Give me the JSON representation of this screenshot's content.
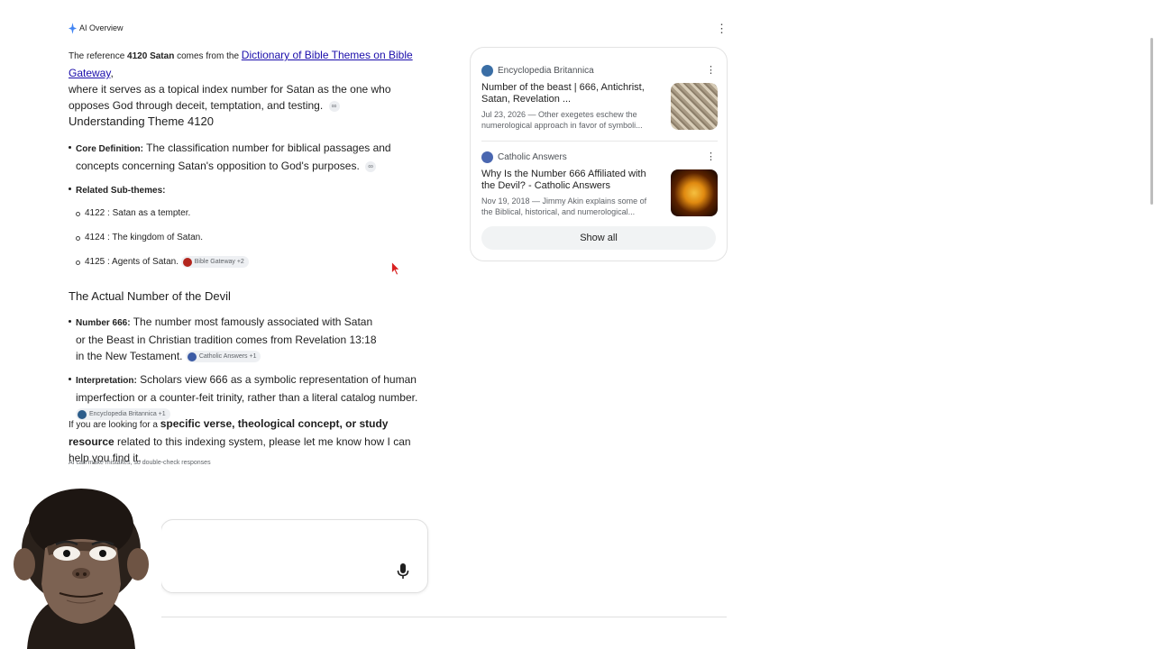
{
  "ai_overview": {
    "label": "AI Overview",
    "intro": {
      "t1": "The reference ",
      "t2": "4120 Satan",
      "t3": " comes from the ",
      "link": "Dictionary of Bible Themes on Bible Gateway",
      "t4": ",",
      "t5": "where it serves as a topical index number for Satan as the one who opposes God through deceit, temptation, and testing."
    },
    "section1": {
      "heading": "Understanding Theme 4120",
      "bullets": [
        {
          "bold": "Core Definition:",
          "text": " The classification number for biblical passages and concepts concerning Satan's opposition to God's purposes."
        },
        {
          "bold": "Related Sub-themes:",
          "text": ""
        }
      ],
      "subthemes": [
        "4122 : Satan as a tempter.",
        "4124 : The kingdom of Satan.",
        "4125 : Agents of Satan."
      ],
      "chip": "Bible Gateway +2"
    },
    "section2": {
      "heading": "The Actual Number of the Devil",
      "bullets": [
        {
          "bold": "Number 666:",
          "text": " The number most famously associated with Satan or the Beast in Christian tradition comes from Revelation 13:18 in the New Testament.",
          "chip": "Catholic Answers +1"
        },
        {
          "bold": "Interpretation:",
          "text": " Scholars view 666 as a symbolic representation of human imperfection or a counter-feit trinity, rather than a literal catalog number.",
          "chip": "Encyclopedia Britannica +1"
        }
      ]
    },
    "closing": {
      "t1": "If you are looking for a ",
      "bold": "specific verse, theological concept, or study resource",
      "t2": " related to this indexing system, please let me know how I can help you find it."
    },
    "disclaimer": "AI can make mistakes, so double-check responses"
  },
  "sources": [
    {
      "site": "Encyclopedia Britannica",
      "title": "Number of the beast | 666, Antichrist, Satan, Revelation ...",
      "snippet": "Jul 23, 2026 — Other exegetes eschew the numerological approach in favor of symboli..."
    },
    {
      "site": "Catholic Answers",
      "title": "Why Is the Number 666 Affiliated with the Devil? - Catholic Answers",
      "snippet": "Nov 19, 2018 — Jimmy Akin explains some of the Biblical, historical, and numerological..."
    }
  ],
  "show_all": "Show all",
  "icons": {
    "ai": "sparkle-icon",
    "more": "more-vert-icon",
    "mic": "mic-icon",
    "attach": "link-icon"
  },
  "colors": {
    "link": "#1a0dab",
    "chip_bg": "#eef0f3",
    "panel_border": "#e3e3e3"
  }
}
